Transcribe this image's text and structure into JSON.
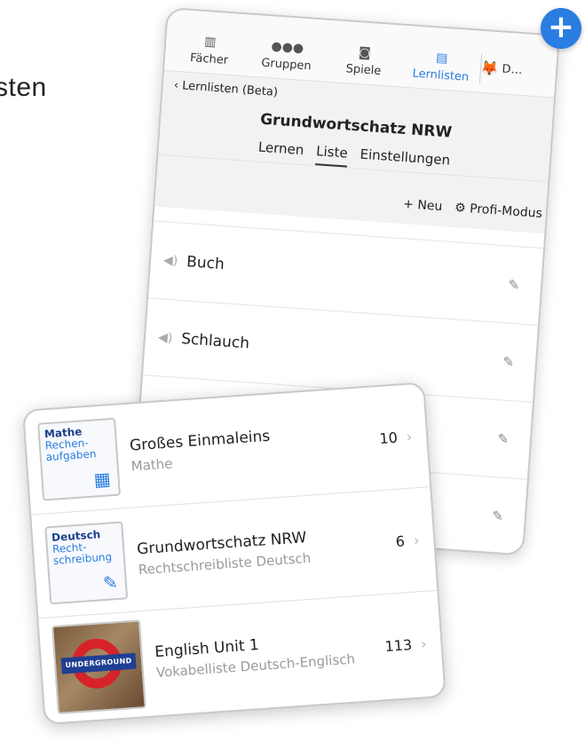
{
  "background_text": "sten",
  "tabs": [
    {
      "label": "Fächer",
      "icon": "books-icon"
    },
    {
      "label": "Gruppen",
      "icon": "group-icon"
    },
    {
      "label": "Spiele",
      "icon": "gamepad-icon"
    },
    {
      "label": "Lernlisten",
      "icon": "list-icon",
      "active": true
    }
  ],
  "user_tab": {
    "label": "D…",
    "icon": "fox-avatar-icon"
  },
  "back_link": "Lernlisten (Beta)",
  "page_title": "Grundwortschatz NRW",
  "segments": [
    {
      "label": "Lernen"
    },
    {
      "label": "Liste",
      "active": true
    },
    {
      "label": "Einstellungen"
    }
  ],
  "toolbar": {
    "new_label": "Neu",
    "profi_label": "Profi-Modus"
  },
  "words": [
    {
      "text": "Buch"
    },
    {
      "text": "Schlauch"
    },
    {
      "text": ""
    },
    {
      "text": ""
    }
  ],
  "lists": [
    {
      "tile_subject": "Mathe",
      "tile_topic": "Rechen-\naufgaben",
      "tile_icon": "calculator-icon",
      "title": "Großes Einmaleins",
      "subtitle": "Mathe",
      "count": "10"
    },
    {
      "tile_subject": "Deutsch",
      "tile_topic": "Recht-\nschreibung",
      "tile_icon": "pencil-icon",
      "title": "Grundwortschatz NRW",
      "subtitle": "Rechtschreibliste Deutsch",
      "count": "6"
    },
    {
      "tile_subject": "",
      "tile_topic": "",
      "tile_icon": "underground-photo",
      "tile_photo_text": "UNDERGROUND",
      "title": "English Unit 1",
      "subtitle": "Vokabelliste Deutsch-Englisch",
      "count": "113"
    }
  ],
  "colors": {
    "accent": "#2a7de1",
    "subject_dark": "#1b3f8f",
    "muted": "#9a9a9a"
  }
}
